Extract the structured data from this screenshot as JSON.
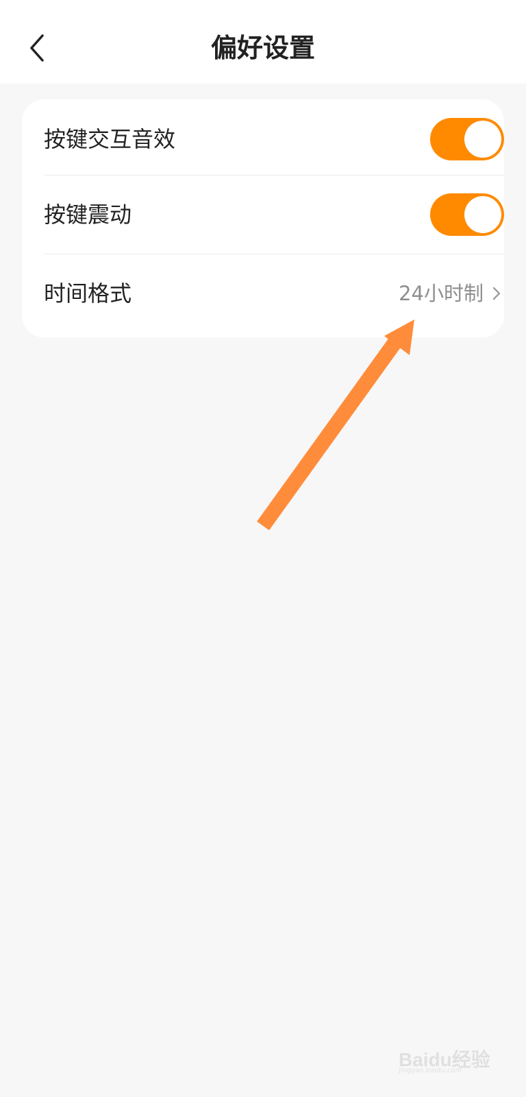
{
  "header": {
    "title": "偏好设置",
    "back_icon": "chevron-left-icon"
  },
  "settings": {
    "items": [
      {
        "label": "按键交互音效",
        "type": "toggle",
        "state": "on"
      },
      {
        "label": "按键震动",
        "type": "toggle",
        "state": "on"
      },
      {
        "label": "时间格式",
        "type": "link",
        "value": "24小时制",
        "icon": "chevron-right-icon"
      }
    ]
  },
  "colors": {
    "accent": "#ff8a00",
    "annotation_arrow": "#ff8c3a",
    "background": "#f7f7f7"
  },
  "watermark": {
    "logo": "Baidu经验",
    "url": "jingyan.baidu.com"
  }
}
